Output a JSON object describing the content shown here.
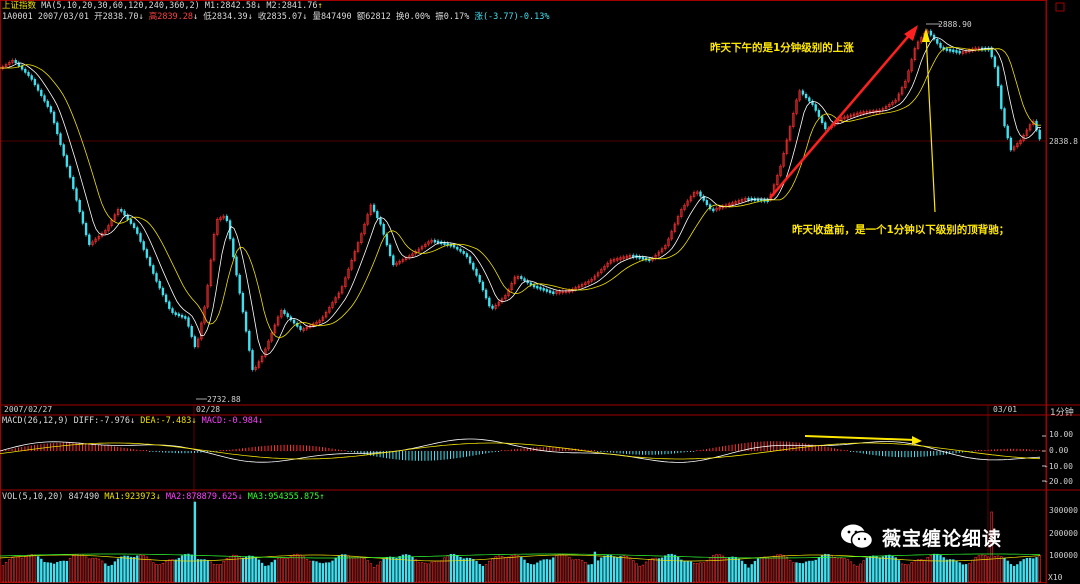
{
  "header": {
    "index_name": "上证指数",
    "ma_label": "MA(5,10,20,30,60,120,240,360,2)",
    "m1": "M1:2842.58",
    "m1_arrow": "↓",
    "m2": "M2:2841.76",
    "m2_arrow": "↑",
    "symbol_date": "1A0001 2007/03/01",
    "open": "开2838.70",
    "open_arrow": "↓",
    "high": "高2839.28",
    "high_arrow": "↓",
    "low": "低2834.39",
    "low_arrow": "↓",
    "close": "收2835.07",
    "close_arrow": "↓",
    "volume": "量847490",
    "amount": "额62812",
    "turnover": "换0.00%",
    "amplitude": "振0.17%",
    "change": "涨(-3.77)-0.13%"
  },
  "annotations": {
    "top": "昨天下午的是1分钟级别的上涨",
    "bottom": "昨天收盘前，是一个1分钟以下级别的顶背驰；"
  },
  "price_labels": {
    "high_mark": "2888.90",
    "low_mark": "2732.88",
    "axis_right": "2838.8"
  },
  "date_axis": {
    "left": "2007/02/27",
    "mid": "02/28",
    "right": "03/01",
    "period": "1分钟"
  },
  "macd": {
    "label": "MACD(26,12,9)",
    "diff": "DIFF:-7.976",
    "diff_arrow": "↓",
    "dea": "DEA:-7.483",
    "dea_arrow": "↓",
    "macd": "MACD:-0.984",
    "macd_arrow": "↓",
    "ticks": [
      "10.00",
      "0.00",
      "-10.00",
      "-20.00"
    ]
  },
  "vol": {
    "label": "VOL(5,10,20)",
    "value": "847490",
    "ma1": "MA1:923973",
    "ma1_arrow": "↓",
    "ma2": "MA2:878879.625",
    "ma2_arrow": "↓",
    "ma3": "MA3:954355.875",
    "ma3_arrow": "↑",
    "ticks": [
      "300000",
      "200000",
      "100000"
    ],
    "unit": "X10"
  },
  "watermark": "薇宝缠论细读",
  "colors": {
    "up": "#ff3030",
    "down": "#40e0f0",
    "ma_white": "#ffffff",
    "ma_yellow": "#f0e000",
    "grid_red": "#a00000"
  }
}
